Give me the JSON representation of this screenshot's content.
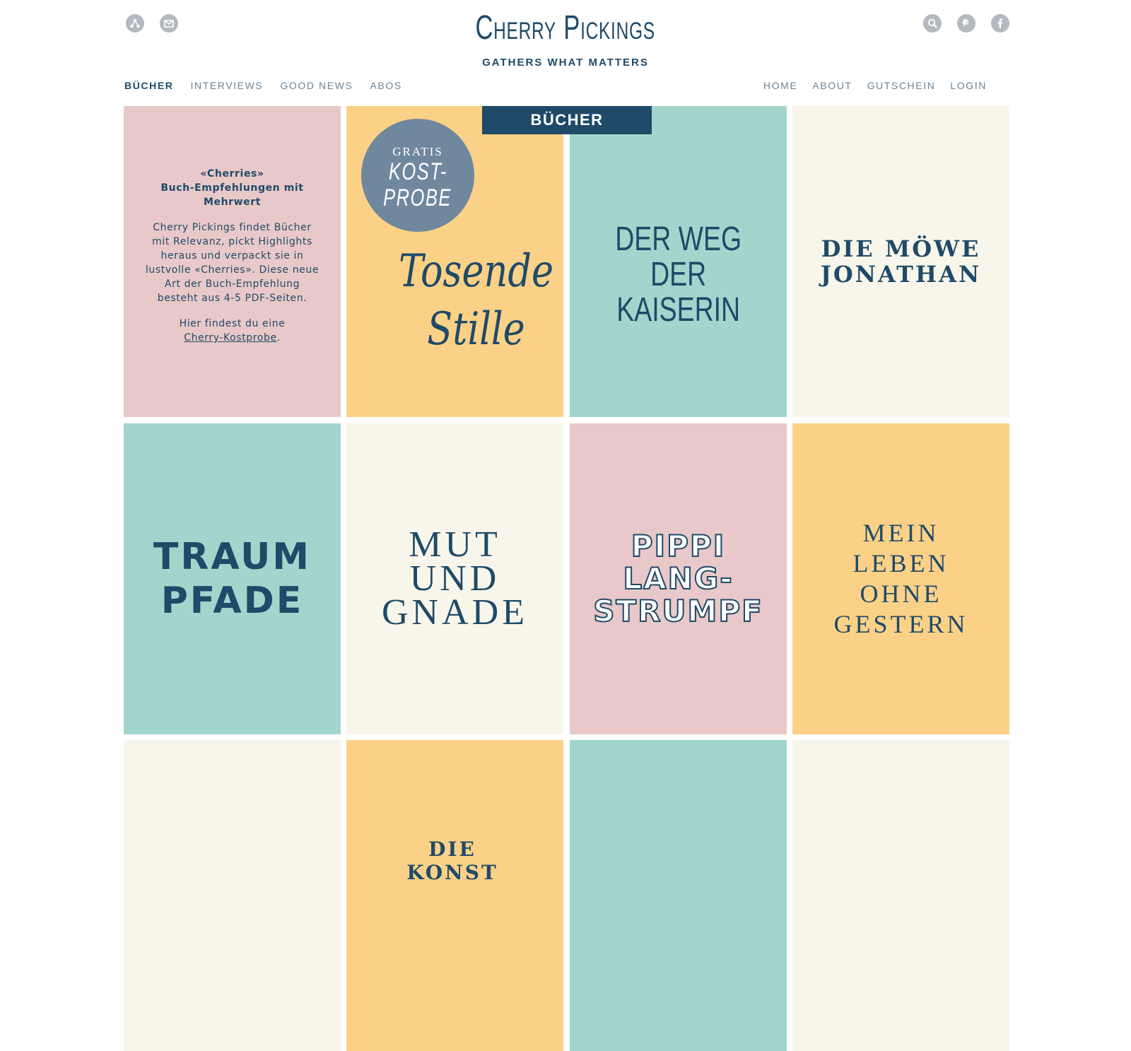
{
  "header": {
    "brand_title": "Cherry Pickings",
    "brand_tagline": "GATHERS WHAT MATTERS",
    "left_icons": [
      "share-icon",
      "mail-icon"
    ],
    "right_icons": [
      "search-icon",
      "pinterest-icon",
      "facebook-icon"
    ],
    "icon_color": "#b3b9bf"
  },
  "nav": {
    "left": [
      {
        "label": "BÜCHER",
        "active": true
      },
      {
        "label": "INTERVIEWS",
        "active": false
      },
      {
        "label": "GOOD NEWS",
        "active": false
      },
      {
        "label": "ABOS",
        "active": false
      }
    ],
    "right": [
      {
        "label": "HOME"
      },
      {
        "label": "ABOUT"
      },
      {
        "label": "GUTSCHEIN"
      },
      {
        "label": "LOGIN"
      }
    ]
  },
  "section_tab": "BÜCHER",
  "intro": {
    "heading_line1": "«Cherries»",
    "heading_line2": "Buch-Empfehlungen mit Mehrwert",
    "body": "Cherry Pickings findet Bücher mit Relevanz, pickt Highlights heraus und verpackt sie in lustvolle «Cherries». Diese neue Art der Buch-Empfehlung besteht aus 4-5 PDF-Seiten.",
    "link_prefix": "Hier findest du eine",
    "link_text": "Cherry-Kostprobe",
    "link_suffix": "."
  },
  "badge": {
    "line1": "GRATIS",
    "line2": "KOST-",
    "line3": "PROBE"
  },
  "books": [
    {
      "title": "Tosende\nStille",
      "color": "#fbd187"
    },
    {
      "title": "DER WEG\nDER\nKAISERIN",
      "color": "#a2d6cd"
    },
    {
      "title": "DIE MÖWE\nJONATHAN",
      "color": "#f8f6ea"
    },
    {
      "title": "TRAUM\nPFADE",
      "color": "#a2d6cd"
    },
    {
      "title": "MUT\nUND\nGNADE",
      "color": "#f8f6ea"
    },
    {
      "title": "PIPPI\nLANG-\nSTRUMPF",
      "color": "#e8c8c8"
    },
    {
      "title": "MEIN\nLEBEN\nOHNE\nGESTERN",
      "color": "#fbd187"
    }
  ],
  "partial_title": "DIE KONST",
  "colors": {
    "navy": "#1f4a68",
    "pink": "#e8c8c8",
    "yellow": "#fbd187",
    "teal": "#a2d6cd",
    "cream": "#f8f6ea",
    "badge": "#70889e"
  }
}
